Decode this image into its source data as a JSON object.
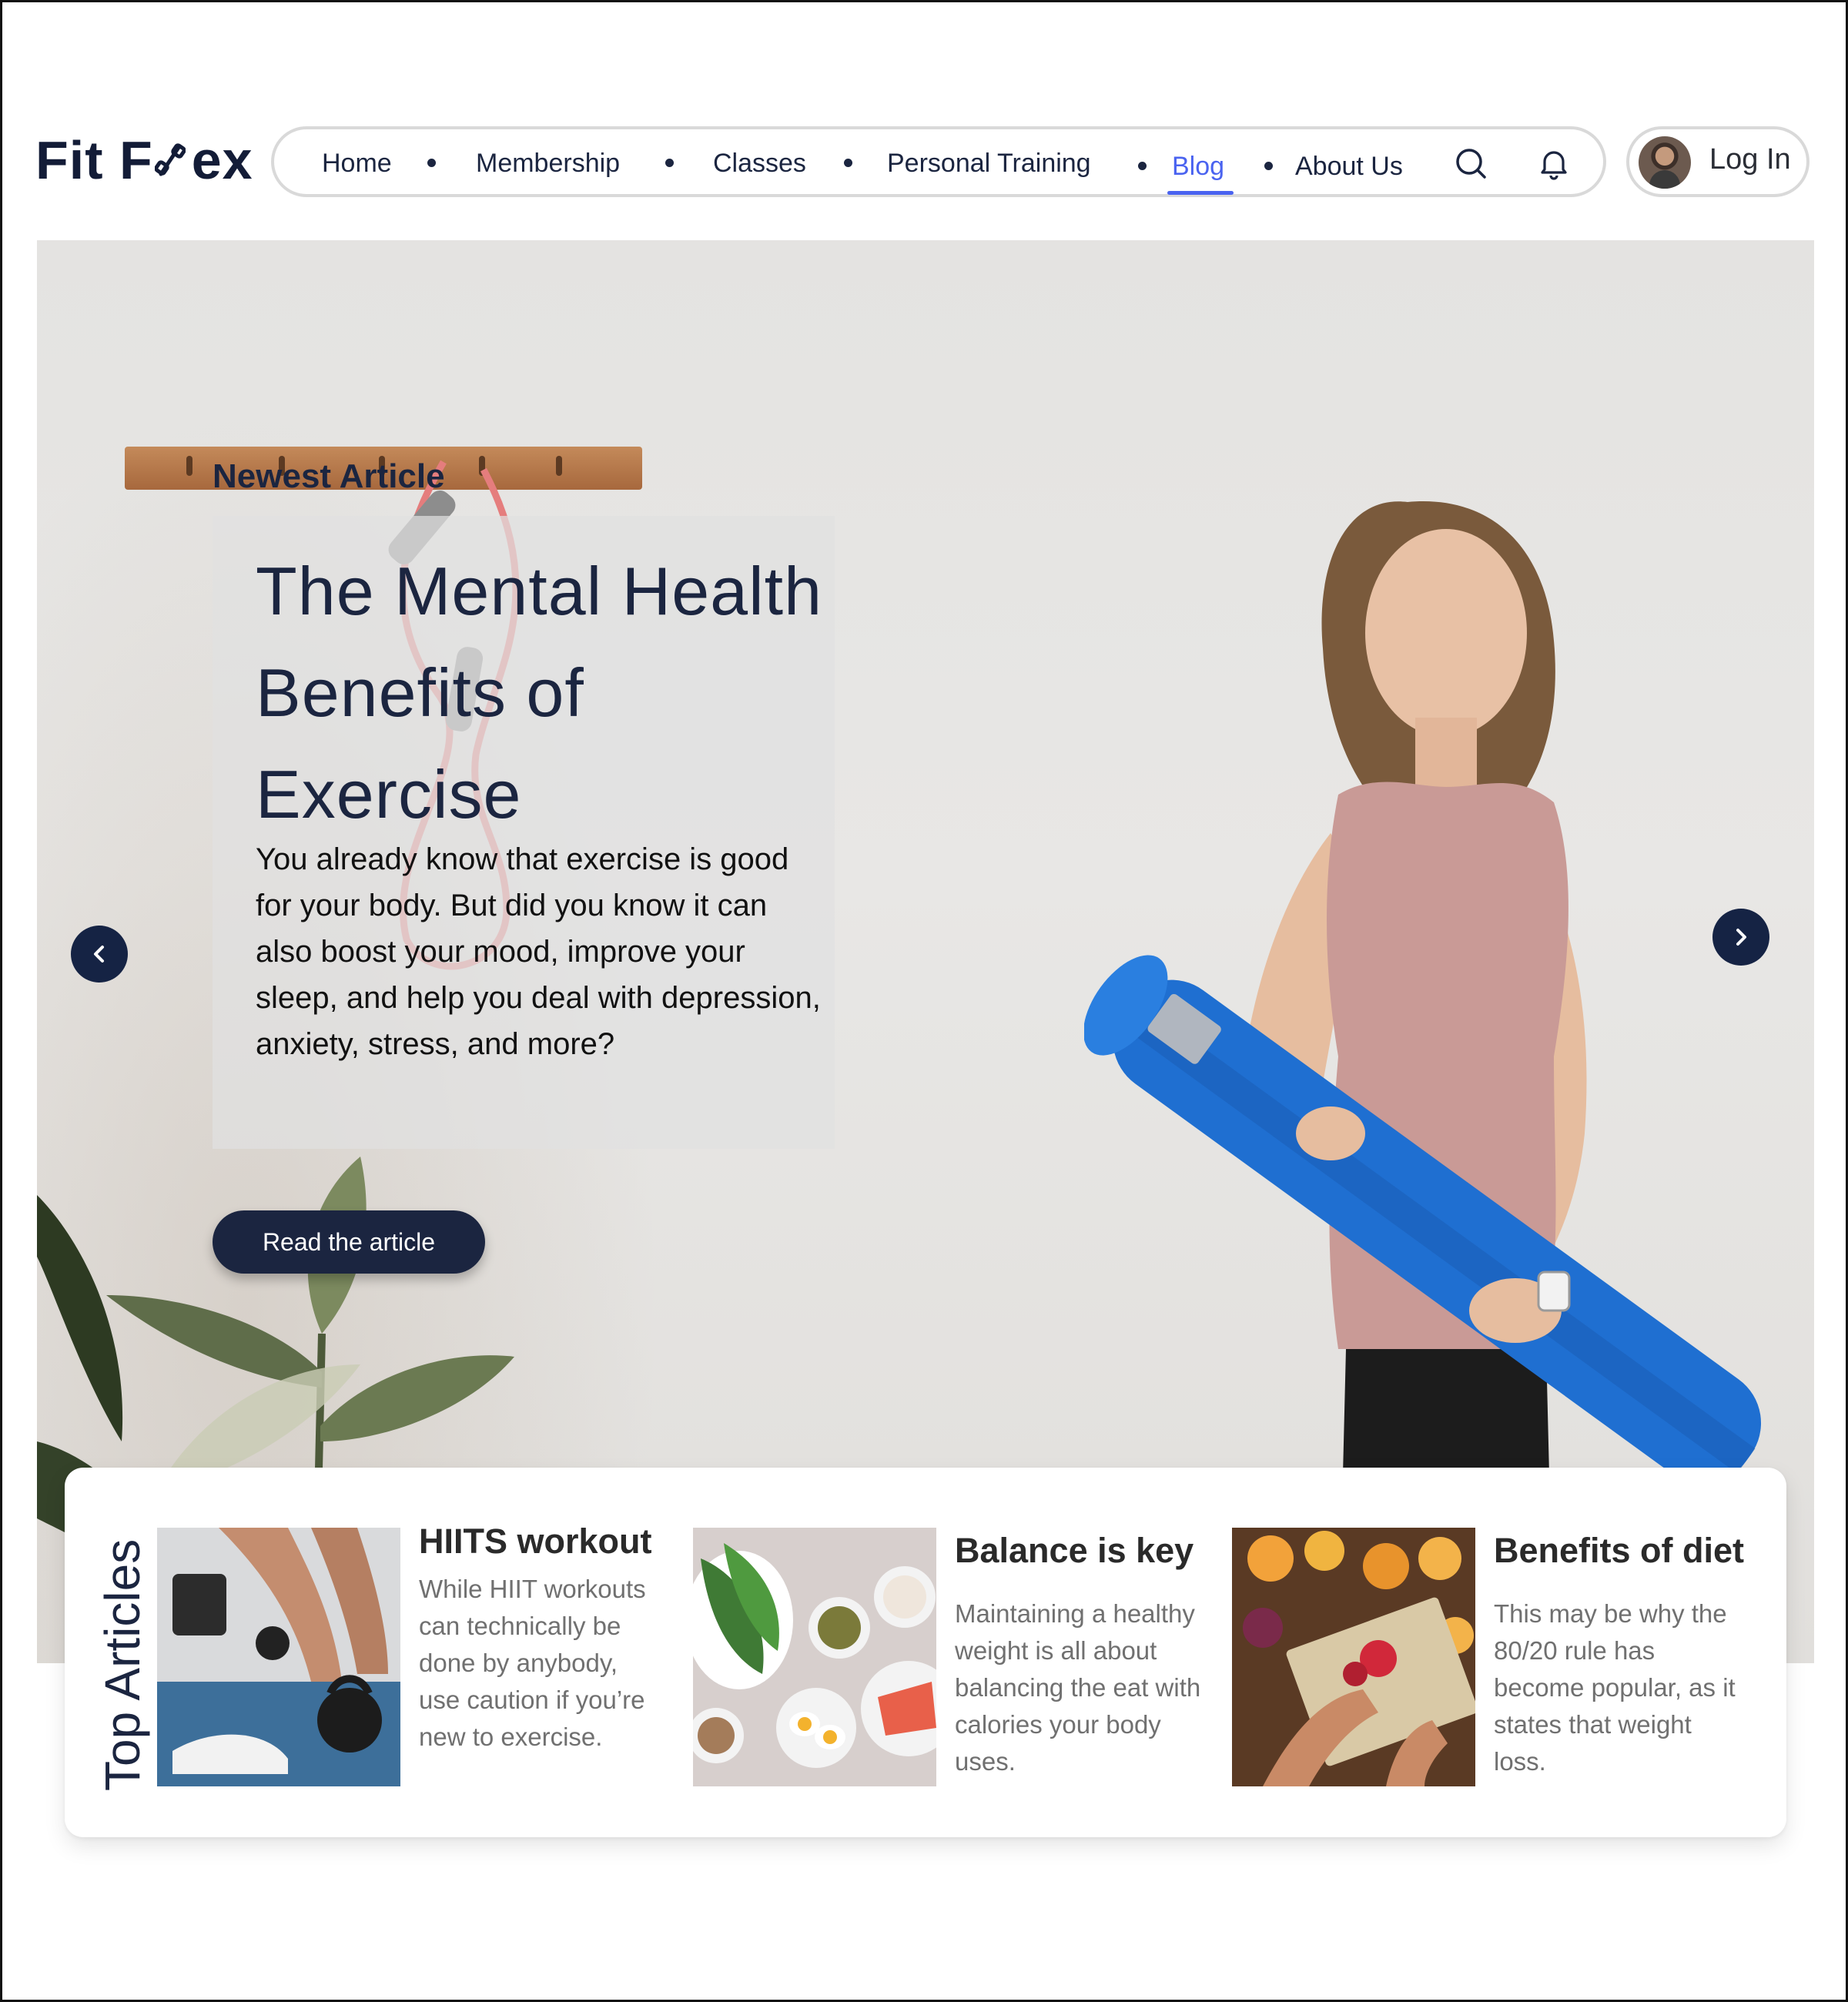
{
  "brand": {
    "name": "Fit Flex",
    "name_left": "Fit F",
    "name_right": "ex"
  },
  "nav": {
    "items": [
      {
        "label": "Home"
      },
      {
        "label": "Membership"
      },
      {
        "label": "Classes"
      },
      {
        "label": "Personal Training"
      },
      {
        "label": "Blog",
        "active": true
      },
      {
        "label": "About Us"
      }
    ],
    "icons": [
      "search-icon",
      "bell-icon"
    ]
  },
  "login": {
    "label": "Log In"
  },
  "hero": {
    "kicker": "Newest Article",
    "title": "The Mental Health Benefits of Exercise",
    "text": "You already know that exercise is good for your body. But did you know it can also boost your mood, improve your sleep, and help you deal with depression, anxiety, stress, and more?",
    "cta": "Read the article",
    "prev_icon": "chevron-left-icon",
    "next_icon": "chevron-right-icon"
  },
  "top_articles": {
    "heading": "Top Articles",
    "items": [
      {
        "title": "HIITS workout",
        "text": "While HIIT workouts can technically be done by anybody, use caution if you’re new to exercise."
      },
      {
        "title": "Balance is key",
        "text": "Maintaining a healthy weight is all about balancing the eat with  calories your body uses."
      },
      {
        "title": "Benefits of diet",
        "text": "This may be why the 80/20 rule has become popular, as it states that weight loss."
      }
    ]
  },
  "colors": {
    "navy": "#1b2540",
    "accent": "#4a63f0",
    "mat_blue": "#1f6fd1",
    "top_pink": "#c99a96"
  }
}
